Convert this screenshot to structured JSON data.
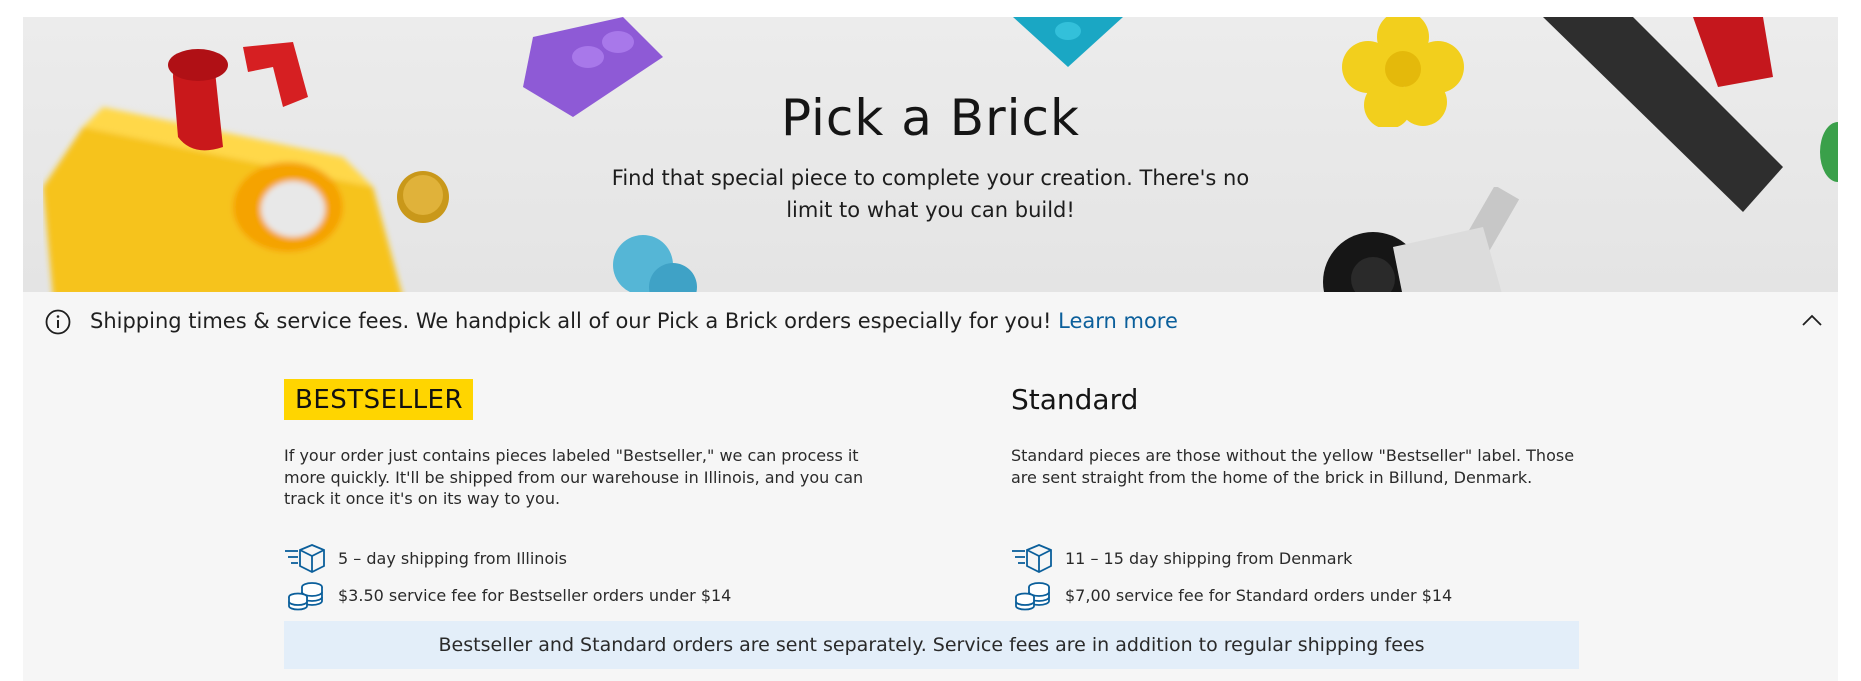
{
  "hero": {
    "title": "Pick a Brick",
    "subtitle": "Find that special piece to complete your creation. There's no limit to what you can build!"
  },
  "shipping_bar": {
    "text": "Shipping times & service fees. We handpick all of our Pick a Brick orders especially for you!",
    "link": "Learn more"
  },
  "bestseller": {
    "badge": "BESTSELLER",
    "description": "If your order just contains pieces labeled \"Bestseller,\" we can process it more quickly. It'll be shipped from our warehouse in Illinois, and you can track it once it's on its way to you.",
    "shipping": "5 – day shipping from Illinois",
    "fee": "$3.50 service fee for Bestseller orders under $14"
  },
  "standard": {
    "title": "Standard",
    "description": "Standard pieces are those without the yellow \"Bestseller\" label. Those are sent straight from the home of the brick in Billund, Denmark.",
    "shipping": "11 – 15 day shipping from Denmark",
    "fee": "$7,00 service fee for Standard orders under $14"
  },
  "note": "Bestseller and Standard orders are sent separately. Service fees are in addition to regular shipping fees",
  "colors": {
    "badge": "#ffd500",
    "link": "#0b5f9b",
    "icon": "#0b5f9b",
    "note_bg": "#e3eef9"
  },
  "icons": [
    "info-icon",
    "chevron-up-icon",
    "shipping-box-icon",
    "coins-icon"
  ]
}
